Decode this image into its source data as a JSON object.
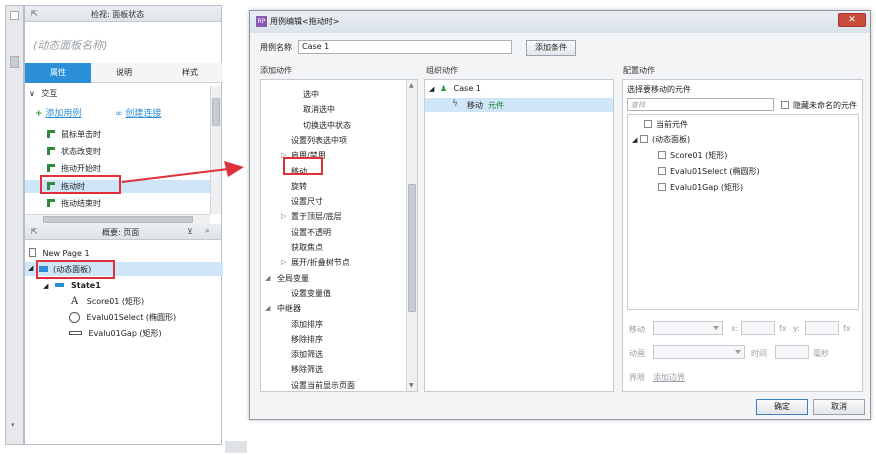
{
  "inspector": {
    "title": "检视: 面板状态",
    "panel_name_placeholder": "(动态面板名称)",
    "tabs": [
      "属性",
      "说明",
      "样式"
    ],
    "section": "交互",
    "add_case": "添加用例",
    "create_link": "创建连接",
    "events": [
      "鼠标单击时",
      "状态改变时",
      "拖动开始时",
      "拖动时",
      "拖动结束时"
    ]
  },
  "outline": {
    "title": "概要: 页面",
    "page": "New Page 1",
    "panel": "(动态面板)",
    "state": "State1",
    "items": [
      "Score01 (矩形)",
      "Evalu01Select (椭圆形)",
      "Evalu01Gap (矩形)"
    ],
    "text_glyph": "A"
  },
  "dialog": {
    "title": "用例编辑<拖动时>",
    "case_name_label": "用例名称",
    "case_name_value": "Case 1",
    "add_condition": "添加条件",
    "col_add": "添加动作",
    "col_organize": "组织动作",
    "col_config": "配置动作",
    "actions": [
      {
        "label": "选中",
        "indent": 2,
        "exp": ""
      },
      {
        "label": "取消选中",
        "indent": 2,
        "exp": ""
      },
      {
        "label": "切换选中状态",
        "indent": 2,
        "exp": ""
      },
      {
        "label": "设置列表选中项",
        "indent": 1,
        "exp": ""
      },
      {
        "label": "启用/禁用",
        "indent": 1,
        "exp": "▷"
      },
      {
        "label": "移动",
        "indent": 1,
        "exp": ""
      },
      {
        "label": "旋转",
        "indent": 1,
        "exp": ""
      },
      {
        "label": "设置尺寸",
        "indent": 1,
        "exp": ""
      },
      {
        "label": "置于顶层/底层",
        "indent": 1,
        "exp": "▷"
      },
      {
        "label": "设置不透明",
        "indent": 1,
        "exp": ""
      },
      {
        "label": "获取焦点",
        "indent": 1,
        "exp": ""
      },
      {
        "label": "展开/折叠树节点",
        "indent": 1,
        "exp": "▷"
      },
      {
        "label": "全局变量",
        "indent": 0,
        "exp": "◢"
      },
      {
        "label": "设置变量值",
        "indent": 1,
        "exp": ""
      },
      {
        "label": "中继器",
        "indent": 0,
        "exp": "◢"
      },
      {
        "label": "添加排序",
        "indent": 1,
        "exp": ""
      },
      {
        "label": "移除排序",
        "indent": 1,
        "exp": ""
      },
      {
        "label": "添加筛选",
        "indent": 1,
        "exp": ""
      },
      {
        "label": "移除筛选",
        "indent": 1,
        "exp": ""
      },
      {
        "label": "设置当前显示页面",
        "indent": 1,
        "exp": ""
      },
      {
        "label": "设置每页项目数量",
        "indent": 1,
        "exp": ""
      }
    ],
    "organize": {
      "case": "Case 1",
      "action": "移动",
      "target": "元件"
    },
    "config": {
      "select_label": "选择要移动的元件",
      "search_placeholder": "查找",
      "hide_unnamed": "隐藏未命名的元件",
      "tree": [
        "当前元件",
        "(动态面板)",
        "Score01 (矩形)",
        "Evalu01Select (椭圆形)",
        "Evalu01Gap (矩形)"
      ],
      "move_label": "移动",
      "x_label": "x:",
      "y_label": "y:",
      "fx": "fx",
      "anim_label": "动画",
      "time_label": "时间",
      "ms_label": "毫秒",
      "bound_label": "界限",
      "add_bound": "添加边界"
    },
    "ok": "确定",
    "cancel": "取消"
  },
  "colors": {
    "accent": "#2b8fd8",
    "selection": "#cfe6f8",
    "highlight": "#e0303a"
  }
}
